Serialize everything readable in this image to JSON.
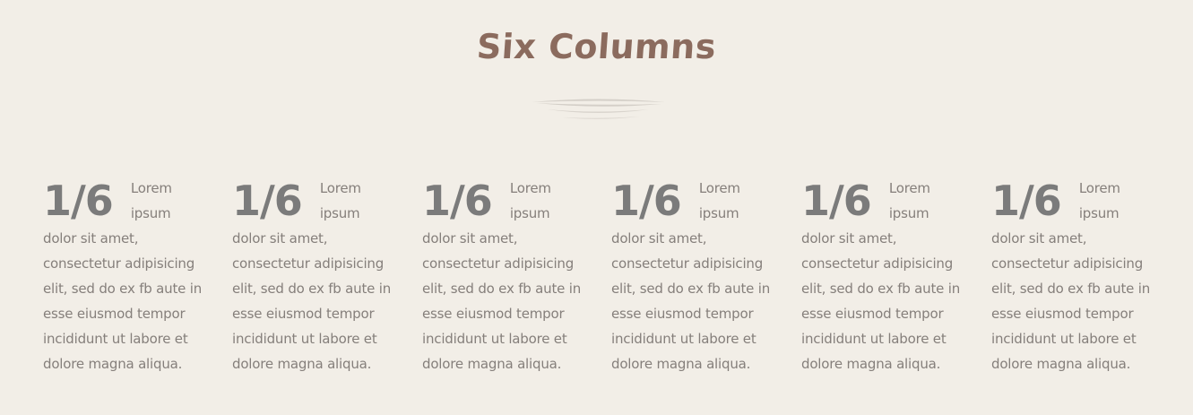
{
  "section": {
    "title": "Six Columns"
  },
  "columns": [
    {
      "fraction": "1/6",
      "text": "Lorem ipsum dolor sit amet, consectetur adipisicing elit, sed do ex fb aute in esse eiusmod tempor incididunt ut labore et dolore magna aliqua."
    },
    {
      "fraction": "1/6",
      "text": "Lorem ipsum dolor sit amet, consectetur adipisicing elit, sed do ex fb aute in esse eiusmod tempor incididunt ut labore et dolore magna aliqua."
    },
    {
      "fraction": "1/6",
      "text": "Lorem ipsum dolor sit amet, consectetur adipisicing elit, sed do ex fb aute in esse eiusmod tempor incididunt ut labore et dolore magna aliqua."
    },
    {
      "fraction": "1/6",
      "text": "Lorem ipsum dolor sit amet, consectetur adipisicing elit, sed do ex fb aute in esse eiusmod tempor incididunt ut labore et dolore magna aliqua."
    },
    {
      "fraction": "1/6",
      "text": "Lorem ipsum dolor sit amet, consectetur adipisicing elit, sed do ex fb aute in esse eiusmod tempor incididunt ut labore et dolore magna aliqua."
    },
    {
      "fraction": "1/6",
      "text": "Lorem ipsum dolor sit amet, consectetur adipisicing elit, sed do ex fb aute in esse eiusmod tempor incididunt ut labore et dolore magna aliqua."
    }
  ],
  "colors": {
    "background": "#f2eee7",
    "title": "#8b6b5e",
    "fraction": "#7b7b7b",
    "body_text": "#857f7b",
    "divider": "#d2cdc6"
  },
  "icons": {
    "divider": "brush-stroke-divider-icon"
  }
}
